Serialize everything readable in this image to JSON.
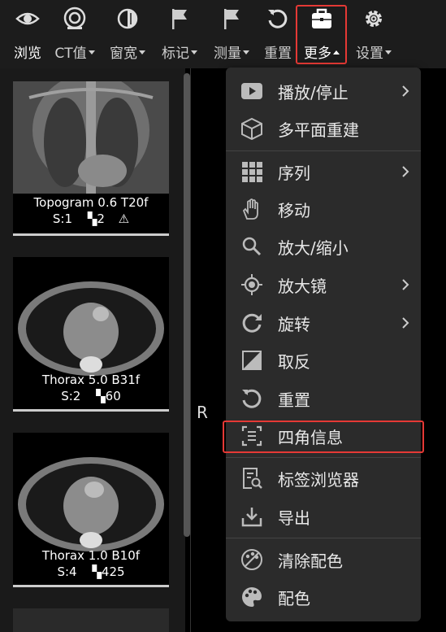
{
  "toolbar": {
    "items": [
      {
        "label": "浏览",
        "icon": "eye-icon",
        "dropdown": false,
        "active": true
      },
      {
        "label": "CT值",
        "icon": "ct-scanner-icon",
        "dropdown": true
      },
      {
        "label": "窗宽",
        "icon": "contrast-icon",
        "dropdown": true
      },
      {
        "label": "标记",
        "icon": "flag-icon",
        "dropdown": true
      },
      {
        "label": "测量",
        "icon": "flag-measure-icon",
        "dropdown": true
      },
      {
        "label": "重置",
        "icon": "reset-icon",
        "dropdown": false
      },
      {
        "label": "更多",
        "icon": "toolbox-icon",
        "dropdown": true,
        "open": true
      },
      {
        "label": "设置",
        "icon": "gear-icon",
        "dropdown": true
      }
    ]
  },
  "series": [
    {
      "name": "Topogram 0.6 T20f",
      "series_label": "S:1",
      "image_count": "2",
      "warning": true
    },
    {
      "name": "Thorax 5.0 B31f",
      "series_label": "S:2",
      "image_count": "60",
      "warning": false
    },
    {
      "name": "Thorax 1.0 B10f",
      "series_label": "S:4",
      "image_count": "425",
      "warning": false
    }
  ],
  "viewer": {
    "orientation_marker": "R"
  },
  "menu": {
    "items": [
      {
        "label": "播放/停止",
        "icon": "play-icon",
        "submenu": true
      },
      {
        "label": "多平面重建",
        "icon": "cube-icon",
        "submenu": false
      },
      {
        "label": "序列",
        "icon": "grid-icon",
        "submenu": true
      },
      {
        "label": "移动",
        "icon": "hand-icon",
        "submenu": false
      },
      {
        "label": "放大/缩小",
        "icon": "magnifier-icon",
        "submenu": false
      },
      {
        "label": "放大镜",
        "icon": "target-icon",
        "submenu": true
      },
      {
        "label": "旋转",
        "icon": "rotate-icon",
        "submenu": true
      },
      {
        "label": "取反",
        "icon": "invert-icon",
        "submenu": false
      },
      {
        "label": "重置",
        "icon": "reset-icon",
        "submenu": false
      },
      {
        "label": "四角信息",
        "icon": "corner-info-icon",
        "submenu": false,
        "highlighted": true
      },
      {
        "label": "标签浏览器",
        "icon": "tag-browser-icon",
        "submenu": false
      },
      {
        "label": "导出",
        "icon": "export-icon",
        "submenu": false
      },
      {
        "label": "清除配色",
        "icon": "clear-palette-icon",
        "submenu": false
      },
      {
        "label": "配色",
        "icon": "palette-icon",
        "submenu": false
      }
    ]
  },
  "colors": {
    "highlight": "#e53935",
    "menu_bg": "#2b2b2b",
    "toolbar_bg": "#1c1c1c"
  }
}
